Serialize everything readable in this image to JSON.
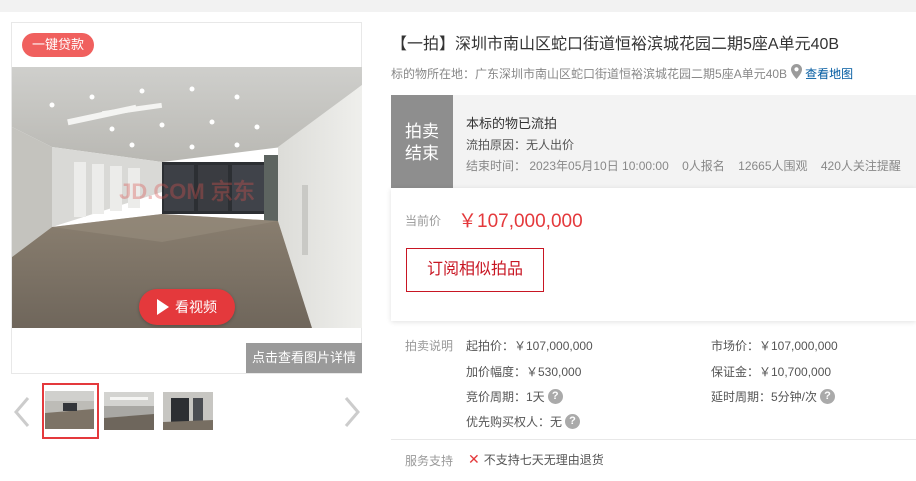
{
  "gallery": {
    "loan_badge": "一键贷款",
    "video_label": "看视频",
    "detail_label": "点击查看图片详情",
    "watermark": "JD.COM 京东",
    "icons": {
      "play": "play-icon",
      "prev": "chevron-left-icon",
      "next": "chevron-right-icon"
    }
  },
  "item": {
    "title": "【一拍】深圳市南山区蛇口街道恒裕滨城花园二期5座A单元40B",
    "location_label": "标的物所在地：",
    "location_value": "广东深圳市南山区蛇口街道恒裕滨城花园二期5座A单元40B",
    "map_link": "查看地图"
  },
  "status": {
    "tag": "拍卖\n结束",
    "tag_line1": "拍卖",
    "tag_line2": "结束",
    "title": "本标的物已流拍",
    "reason": "流拍原因：无人出价",
    "end_time": "结束时间：  2023年05月10日 10:00:00",
    "signups": "0人报名",
    "viewers": "12665人围观",
    "reminders": "420人关注提醒"
  },
  "price": {
    "label": "当前价",
    "value": "￥107,000,000",
    "subscribe_label": "订阅相似拍品"
  },
  "rules": {
    "label": "拍卖说明",
    "start_price": "起拍价：￥107,000,000",
    "market_price": "市场价：￥107,000,000",
    "increment": "加价幅度：￥530,000",
    "deposit": "保证金：￥10,700,000",
    "bid_period": "竞价周期：1天",
    "delay_period": "延时周期：5分钟/次",
    "priority_buyer": "优先购买权人：无"
  },
  "service": {
    "label": "服务支持",
    "no_return": "不支持七天无理由退货"
  },
  "colors": {
    "accent_red": "#e4393c",
    "badge_red": "#f0605e",
    "link_blue": "#005aa0",
    "status_gray": "#8e8e8e"
  }
}
